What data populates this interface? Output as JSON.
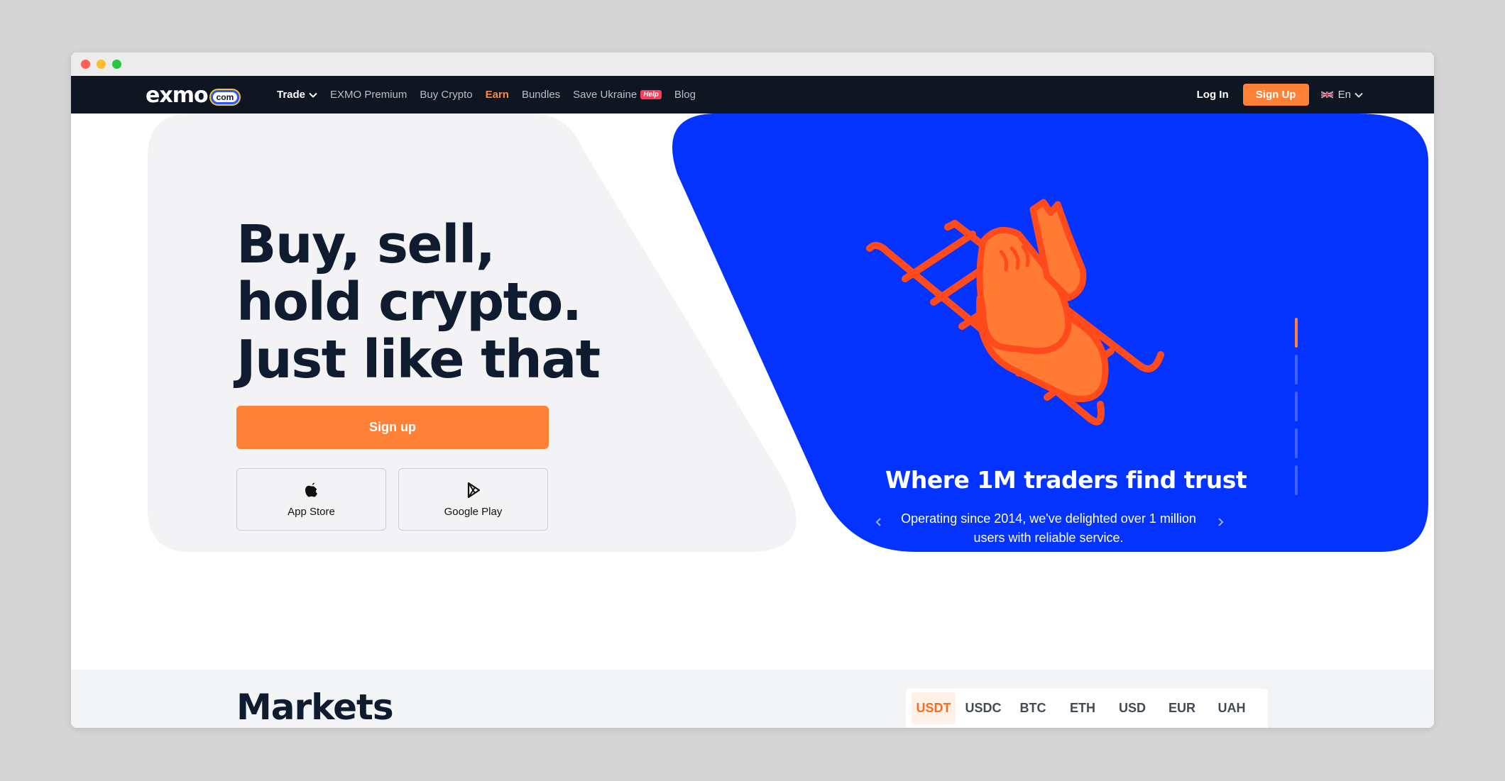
{
  "nav": {
    "logo_text": "exmo",
    "logo_badge": "com",
    "links": [
      {
        "label": "Trade"
      },
      {
        "label": "EXMO Premium"
      },
      {
        "label": "Buy Crypto"
      },
      {
        "label": "Earn"
      },
      {
        "label": "Bundles"
      },
      {
        "label": "Save Ukraine",
        "badge": "Help"
      },
      {
        "label": "Blog"
      }
    ],
    "login": "Log In",
    "signup": "Sign Up",
    "language": "En"
  },
  "hero": {
    "title_lines": [
      "Buy, sell,",
      "hold crypto.",
      "Just like that"
    ],
    "cta": "Sign up",
    "stores": [
      {
        "label": "App Store",
        "icon": "apple-icon"
      },
      {
        "label": "Google Play",
        "icon": "google-play-icon"
      }
    ]
  },
  "slider": {
    "title": "Where 1M traders find trust",
    "text": "Operating since 2014, we've delighted over 1 million users with reliable service.",
    "slide_count": 5,
    "active_index": 0
  },
  "markets": {
    "title": "Markets",
    "tabs": [
      "USDT",
      "USDC",
      "BTC",
      "ETH",
      "USD",
      "EUR",
      "UAH"
    ],
    "active_tab": "USDT"
  },
  "colors": {
    "accent": "#ff8138",
    "nav_bg": "#0f1521",
    "hero_blue": "#0433ff",
    "illustration": "#ff4a1c"
  }
}
